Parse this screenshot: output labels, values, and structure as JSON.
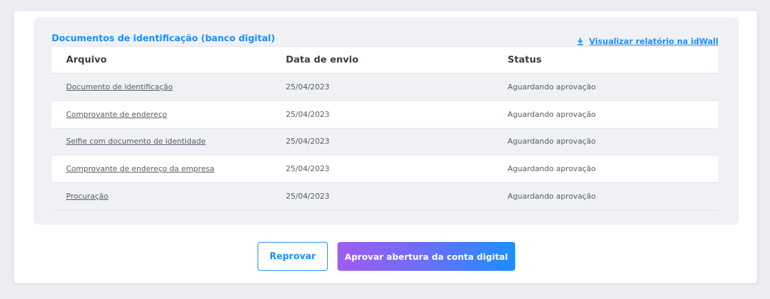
{
  "panel": {
    "title": "Documentos de identificação (banco digital)",
    "report_link": "Visualizar relatório na idWall",
    "report_icon": "download-icon"
  },
  "table": {
    "headers": [
      "Arquivo",
      "Data de envio",
      "Status"
    ],
    "rows": [
      {
        "file": "Documento de identificação",
        "date": "25/04/2023",
        "status": "Aguardando aprovação"
      },
      {
        "file": "Comprovante de endereço",
        "date": "25/04/2023",
        "status": "Aguardando aprovação"
      },
      {
        "file": "Selfie com documento de identidade",
        "date": "25/04/2023",
        "status": "Aguardando aprovação"
      },
      {
        "file": "Comprovante de endereço da empresa",
        "date": "25/04/2023",
        "status": "Aguardando aprovação"
      },
      {
        "file": "Procuração",
        "date": "25/04/2023",
        "status": "Aguardando aprovação"
      }
    ]
  },
  "actions": {
    "reject_label": "Reprovar",
    "approve_label": "Aprovar abertura da conta digital"
  },
  "colors": {
    "accent": "#1a8fff",
    "gradient_start": "#a05cf0",
    "gradient_end": "#1a8fff"
  }
}
